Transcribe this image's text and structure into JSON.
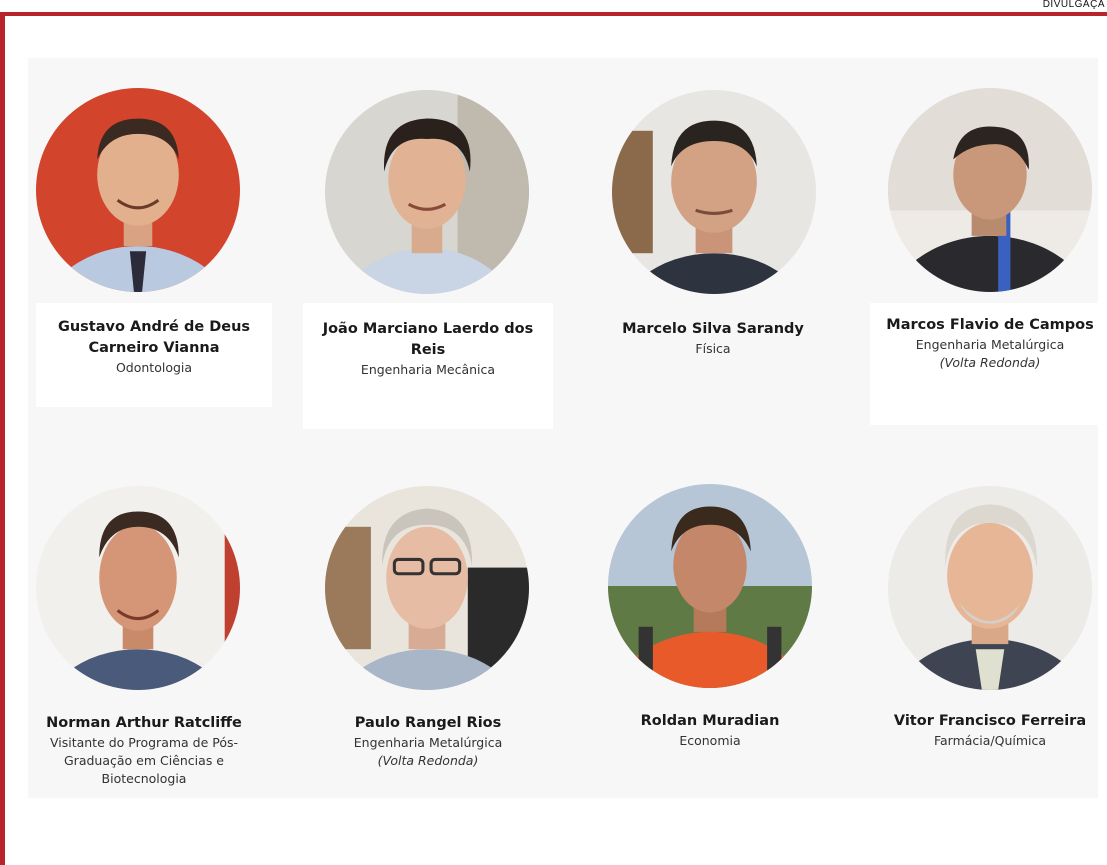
{
  "credit": "DIVULGAÇÃ",
  "people": [
    {
      "name": "Gustavo André de Deus Carneiro Vianna",
      "role": "Odontologia",
      "note": ""
    },
    {
      "name": "João Marciano Laerdo dos Reis",
      "role": "Engenharia Mecânica",
      "note": ""
    },
    {
      "name": "Marcelo Silva Sarandy",
      "role": "Física",
      "note": ""
    },
    {
      "name": "Marcos Flavio de Campos",
      "role": "Engenharia Metalúrgica",
      "note": "(Volta Redonda)"
    },
    {
      "name": "Norman Arthur Ratcliffe",
      "role": "Visitante do Programa de Pós-Graduação em Ciências e Biotecnologia",
      "note": ""
    },
    {
      "name": "Paulo Rangel Rios",
      "role": "Engenharia Metalúrgica",
      "note": "(Volta Redonda)"
    },
    {
      "name": "Roldan Muradian",
      "role": "Economia",
      "note": ""
    },
    {
      "name": "Vitor Francisco Ferreira",
      "role": "Farmácia/Química",
      "note": ""
    }
  ],
  "colors": {
    "frame": "#b7242c",
    "panel": "#f7f7f7"
  }
}
